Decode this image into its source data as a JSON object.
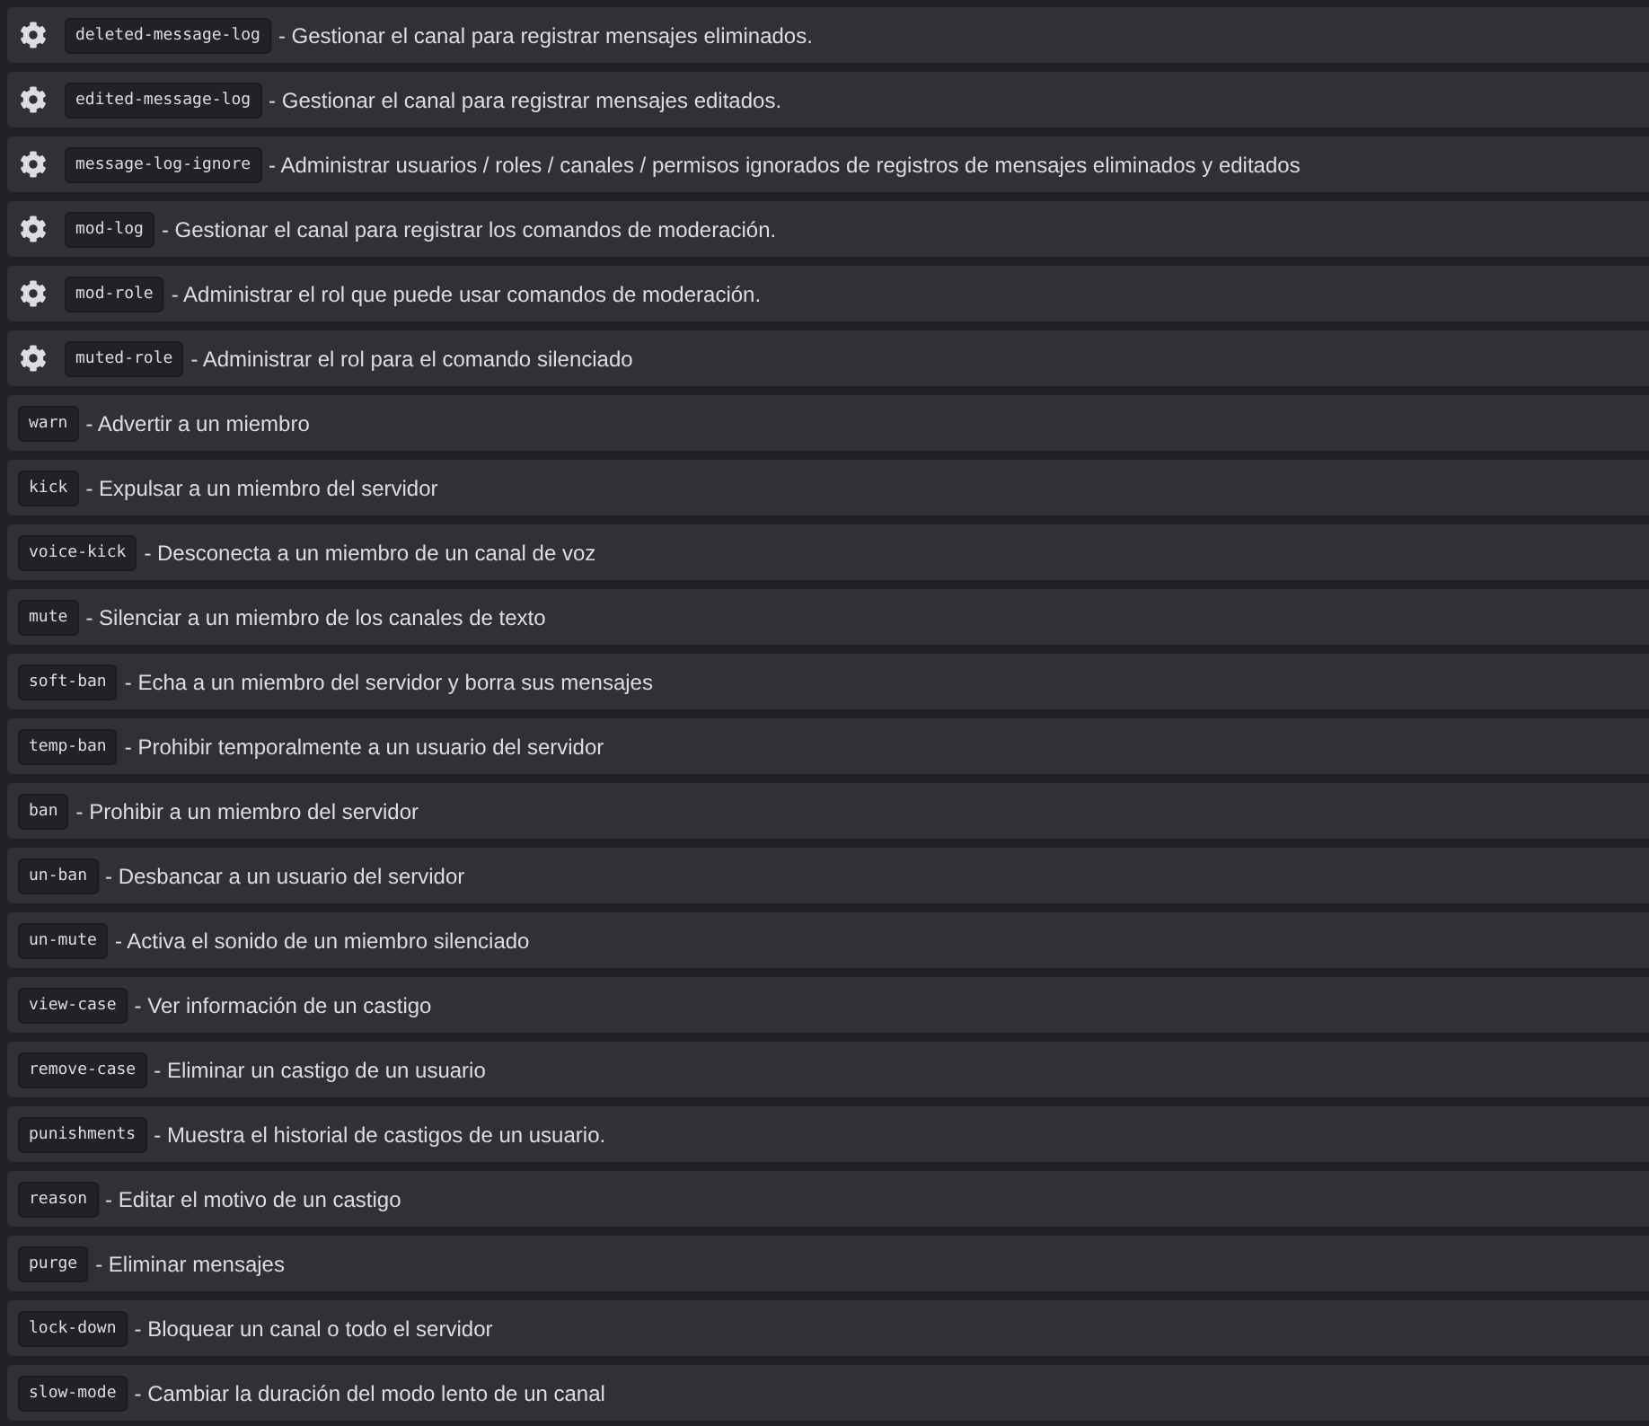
{
  "commands": [
    {
      "kind": "setting",
      "name": "deleted-message-log",
      "description": "- Gestionar el canal para registrar mensajes eliminados."
    },
    {
      "kind": "setting",
      "name": "edited-message-log",
      "description": "- Gestionar el canal para registrar mensajes editados."
    },
    {
      "kind": "setting",
      "name": "message-log-ignore",
      "description": "- Administrar usuarios / roles / canales / permisos ignorados de registros de mensajes eliminados y editados"
    },
    {
      "kind": "setting",
      "name": "mod-log",
      "description": "- Gestionar el canal para registrar los comandos de moderación."
    },
    {
      "kind": "setting",
      "name": "mod-role",
      "description": "- Administrar el rol que puede usar comandos de moderación."
    },
    {
      "kind": "setting",
      "name": "muted-role",
      "description": "- Administrar el rol para el comando silenciado"
    },
    {
      "kind": "command",
      "name": "warn",
      "description": "- Advertir a un miembro"
    },
    {
      "kind": "command",
      "name": "kick",
      "description": "- Expulsar a un miembro del servidor"
    },
    {
      "kind": "command",
      "name": "voice-kick",
      "description": "- Desconecta a un miembro de un canal de voz"
    },
    {
      "kind": "command",
      "name": "mute",
      "description": "- Silenciar a un miembro de los canales de texto"
    },
    {
      "kind": "command",
      "name": "soft-ban",
      "description": "- Echa a un miembro del servidor y borra sus mensajes"
    },
    {
      "kind": "command",
      "name": "temp-ban",
      "description": "- Prohibir temporalmente a un usuario del servidor"
    },
    {
      "kind": "command",
      "name": "ban",
      "description": "- Prohibir a un miembro del servidor"
    },
    {
      "kind": "command",
      "name": "un-ban",
      "description": "- Desbancar a un usuario del servidor"
    },
    {
      "kind": "command",
      "name": "un-mute",
      "description": "- Activa el sonido de un miembro silenciado"
    },
    {
      "kind": "command",
      "name": "view-case",
      "description": "- Ver información de un castigo"
    },
    {
      "kind": "command",
      "name": "remove-case",
      "description": "- Eliminar un castigo de un usuario"
    },
    {
      "kind": "command",
      "name": "punishments",
      "description": "- Muestra el historial de castigos de un usuario."
    },
    {
      "kind": "command",
      "name": "reason",
      "description": "- Editar el motivo de un castigo"
    },
    {
      "kind": "command",
      "name": "purge",
      "description": "- Eliminar mensajes"
    },
    {
      "kind": "command",
      "name": "lock-down",
      "description": "- Bloquear un canal o todo el servidor"
    },
    {
      "kind": "command",
      "name": "slow-mode",
      "description": "- Cambiar la duración del modo lento de un canal"
    }
  ]
}
